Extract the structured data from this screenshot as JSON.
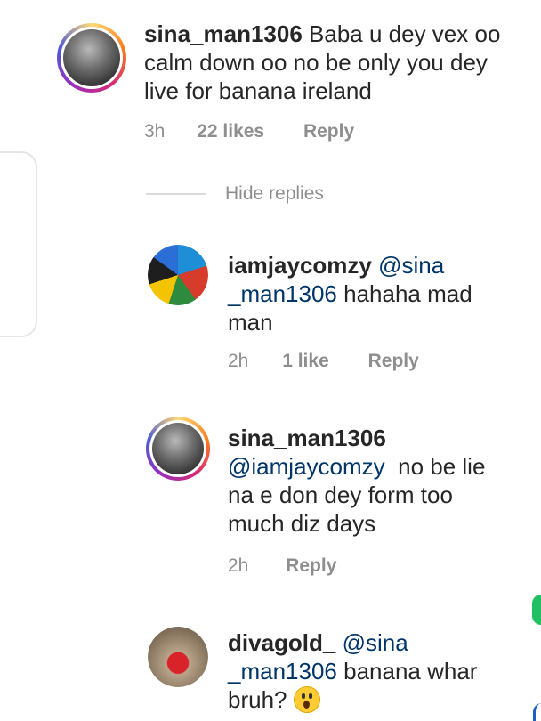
{
  "comments": [
    {
      "username": "sina_man1306",
      "mention": "",
      "text_lines": [
        "Baba u dey vex oo",
        "calm down oo no be only you dey",
        "live for banana ireland"
      ],
      "time": "3h",
      "likes": "22 likes",
      "reply": "Reply"
    }
  ],
  "hide_replies": "Hide replies",
  "replies": [
    {
      "username": "iamjaycomzy",
      "mention_part1": "@sina",
      "mention_part2": "_man1306",
      "text_rest": " hahaha mad",
      "text_line3": "man",
      "time": "2h",
      "likes": "1 like",
      "reply": "Reply"
    },
    {
      "username": "sina_man1306",
      "mention": "@iamjaycomzy",
      "text_rest": "  no be lie",
      "text_line3": "na e don dey form too",
      "text_line4": "much diz days",
      "time": "2h",
      "reply": "Reply"
    },
    {
      "username": "divagold_",
      "mention_part1": "@sina",
      "mention_part2": "_man1306",
      "text_rest": " banana whar",
      "text_line3": "bruh?",
      "emoji": "astonished-face-emoji"
    }
  ],
  "colors": {
    "text": "#262626",
    "muted": "#8e8e8e",
    "mention": "#003569",
    "divider": "#dbdbdb"
  }
}
